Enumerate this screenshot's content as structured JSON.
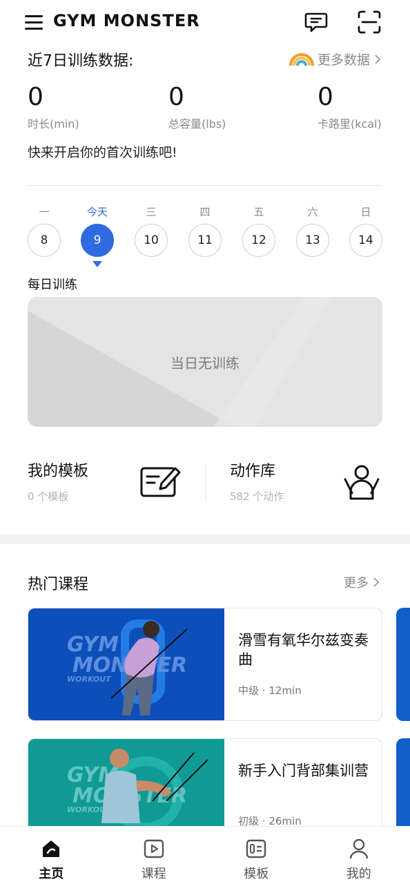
{
  "header": {
    "app_title": "GYM MONSTER",
    "icons": [
      "menu-icon",
      "message-icon",
      "scan-icon"
    ]
  },
  "stats": {
    "title": "近7日训练数据:",
    "more_label": "更多数据",
    "items": [
      {
        "value": "0",
        "label": "时长(min)"
      },
      {
        "value": "0",
        "label": "总容量(lbs)"
      },
      {
        "value": "0",
        "label": "卡路里(kcal)"
      }
    ],
    "encourage": "快来开启你的首次训练吧!"
  },
  "week": {
    "days": [
      {
        "name": "一",
        "date": "8"
      },
      {
        "name": "今天",
        "date": "9"
      },
      {
        "name": "三",
        "date": "10"
      },
      {
        "name": "四",
        "date": "11"
      },
      {
        "name": "五",
        "date": "12"
      },
      {
        "name": "六",
        "date": "13"
      },
      {
        "name": "日",
        "date": "14"
      }
    ],
    "active_index": 1
  },
  "daily": {
    "label": "每日训练",
    "empty_text": "当日无训练"
  },
  "tiles": {
    "templates": {
      "title": "我的模板",
      "sub": "0 个模板"
    },
    "library": {
      "title": "动作库",
      "sub": "582 个动作"
    }
  },
  "hot": {
    "title": "热门课程",
    "more": "更多",
    "courses": [
      {
        "name": "滑雪有氧华尔兹变奏曲",
        "level": "中级",
        "duration": "12min",
        "thumb_word1": "GYM",
        "thumb_word2": "MONSTER",
        "thumb_word3": "WORKOUT",
        "color": "#0d4fb8"
      },
      {
        "name": "新手入门背部集训营",
        "level": "初级",
        "duration": "26min",
        "thumb_word1": "GYM",
        "thumb_word2": "MONSTER",
        "thumb_word3": "WORKOUT",
        "color": "#0f9a95"
      }
    ]
  },
  "nav": [
    {
      "label": "主页",
      "icon": "home-icon",
      "active": true
    },
    {
      "label": "课程",
      "icon": "play-icon",
      "active": false
    },
    {
      "label": "模板",
      "icon": "template-icon",
      "active": false
    },
    {
      "label": "我的",
      "icon": "profile-icon",
      "active": false
    }
  ],
  "colors": {
    "accent": "#2f6be0",
    "course_blue": "#0d4fb8",
    "course_teal": "#0f9a95"
  }
}
